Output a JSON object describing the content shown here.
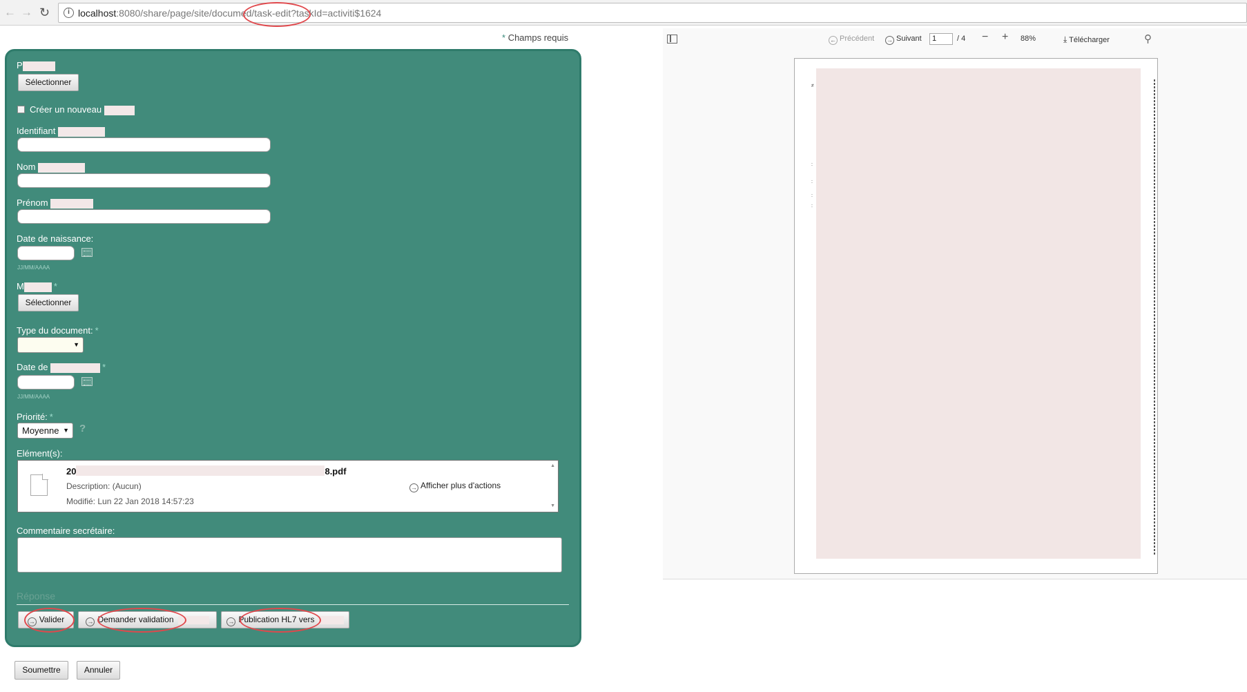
{
  "browser": {
    "back_icon": "arrow-left-icon",
    "forward_icon": "arrow-right-icon",
    "reload_icon": "reload-icon",
    "url_host": "localhost",
    "url_rest": ":8080/share/page/site/documed/task-edit?taskId=activiti$1624"
  },
  "form": {
    "required_note_star": "*",
    "required_note": "Champs requis",
    "patient_label": "P",
    "select_label": "Sélectionner",
    "create_new_label": "Créer un nouveau",
    "identifier_label": "Identifiant",
    "last_name_label": "Nom",
    "first_name_label": "Prénom",
    "birth_date_label": "Date de naissance:",
    "date_hint": "JJ/MM/AAAA",
    "doctor_label": "M",
    "required_star": "*",
    "doc_type_label": "Type du document:",
    "date_of_label": "Date de",
    "priority_label": "Priorité:",
    "priority_value": "Moyenne",
    "help_symbol": "?",
    "items_label": "Elément(s):",
    "comment_label": "Commentaire secrétaire:",
    "response_title": "Réponse"
  },
  "item": {
    "name_prefix": "20",
    "name_suffix": "8.pdf",
    "description": "Description: (Aucun)",
    "modified": "Modifié: Lun 22 Jan 2018 14:57:23",
    "more_actions": "Afficher plus d'actions"
  },
  "actions": {
    "validate": "Valider",
    "request_validation": "Demander validation",
    "publish_hl7": "Publication HL7 vers"
  },
  "footer": {
    "submit": "Soumettre",
    "cancel": "Annuler"
  },
  "viewer": {
    "previous": "Précédent",
    "next": "Suivant",
    "page_current": "1",
    "page_total": "/ 4",
    "zoom": "88%",
    "download": "Télécharger"
  }
}
